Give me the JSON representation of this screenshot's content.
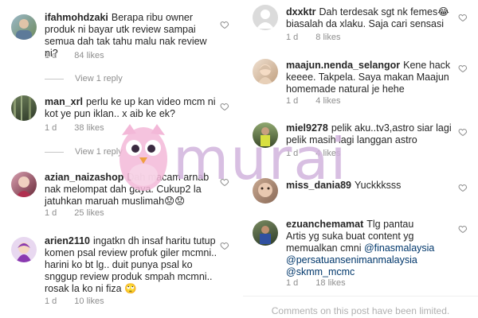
{
  "left_comments": [
    {
      "username": "ifahmohdzaki",
      "text": "Berapa ribu owner produk ni bayar utk review sampai semua dah tak tahu malu nak review ni?",
      "time": "1 d",
      "likes": "84 likes",
      "view_reply": "View 1 reply"
    },
    {
      "username": "man_xrl",
      "text": "perlu ke up kan video mcm ni kot ye pun iklan.. x aib ke ek?",
      "time": "1 d",
      "likes": "38 likes",
      "view_reply": "View 1 reply"
    },
    {
      "username": "azian_naizashop",
      "text": "Dah macam arnab nak melompat dah gaya. Cukup2 la jatuhkan maruah muslimah😟😟",
      "time": "1 d",
      "likes": "25 likes"
    },
    {
      "username": "arien2110",
      "text": "ingatkn dh insaf haritu tutup komen psal review profuk giler mcmni.. harini ko bt lg.. duit punya psal ko snggup review produk smpah mcmni.. rosak la ko ni fiza 🙄",
      "time": "1 d",
      "likes": "10 likes"
    }
  ],
  "right_comments": [
    {
      "username": "dxxktr",
      "text": "Dah terdesak sgt nk femes😂 biasalah da xlaku. Saja cari sensasi",
      "time": "1 d",
      "likes": "8 likes"
    },
    {
      "username": "maajun.nenda_selangor",
      "text": "Kene hack keeee. Takpela. Saya makan Maajun homemade natural je hehe",
      "time": "1 d",
      "likes": "4 likes"
    },
    {
      "username": "miel9278",
      "text": "pelik aku..tv3,astro siar lagi pelik masih lagi langgan astro",
      "time": "1 d",
      "likes": "4 likes"
    },
    {
      "username": "miss_dania89",
      "text": "Yuckkksss",
      "time": "",
      "likes": ""
    },
    {
      "username": "ezuanchemamat",
      "text_lines": [
        "Tlg pantau",
        "Artis yg suka buat content yg memualkan cmni "
      ],
      "mentions": [
        "@finasmalaysia",
        "@persatuansenimanmalaysia",
        "@skmm_mcmc"
      ],
      "time": "1 d",
      "likes": "18 likes"
    }
  ],
  "footer": {
    "limited_text": "Comments on this post have been limited."
  },
  "watermark": {
    "text": "murai"
  },
  "colors": {
    "link": "#00376b",
    "meta": "#8e8e8e",
    "watermark": "#d2b4dd"
  },
  "icons": {
    "like": "heart-outline-icon"
  }
}
